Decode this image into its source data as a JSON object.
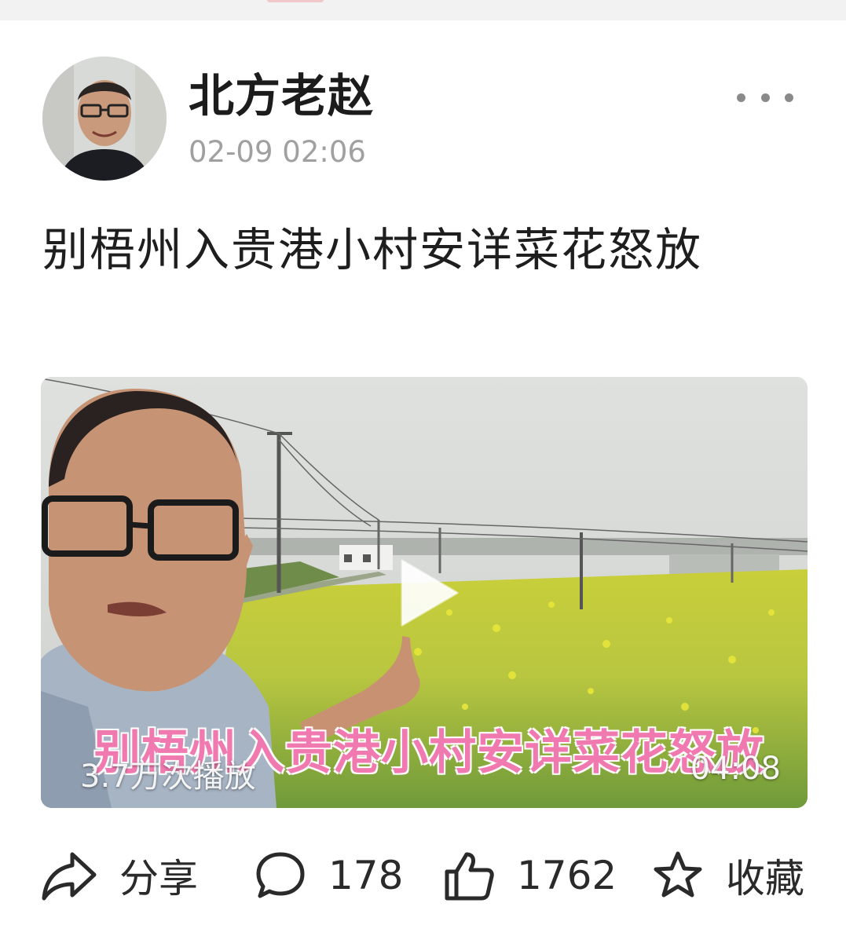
{
  "post": {
    "author_name": "北方老赵",
    "timestamp": "02-09 02:06",
    "title": "别梧州入贵港小村安详菜花怒放"
  },
  "video": {
    "overlay_title": "别梧州入贵港小村安详菜花怒放",
    "view_count": "3.7万次播放",
    "duration": "04:08"
  },
  "actions": {
    "share_label": "分享",
    "comment_count": "178",
    "like_count": "1762",
    "favorite_label": "收藏"
  },
  "icons": {
    "more": "more-dots-icon",
    "share": "share-arrow-icon",
    "comment": "comment-bubble-icon",
    "like": "thumbs-up-icon",
    "favorite": "star-icon",
    "play": "play-icon"
  },
  "colors": {
    "overlay_title": "#f07ab0",
    "timestamp": "#a0a0a0",
    "text": "#1e1e1e"
  }
}
